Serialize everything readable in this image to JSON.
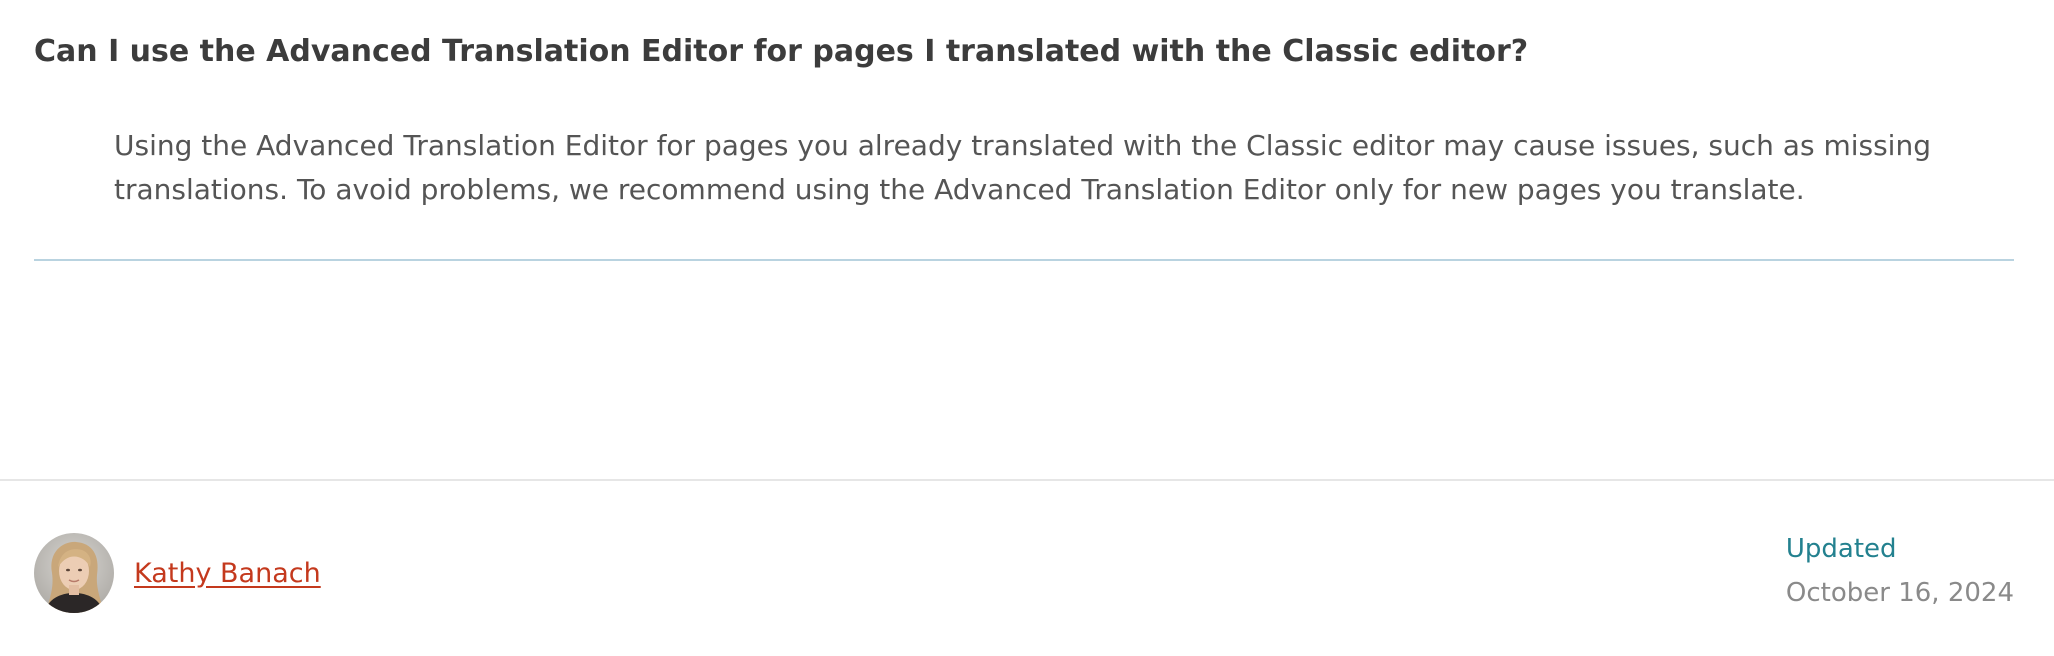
{
  "faq": {
    "question": "Can I use the Advanced Translation Editor for pages I translated with the Classic editor?",
    "answer": "Using the Advanced Translation Editor for pages you already translated with the Classic editor may cause issues, such as missing translations. To avoid problems, we recommend using the Advanced Translation Editor only for new pages you translate."
  },
  "footer": {
    "author": {
      "name": "Kathy Banach",
      "avatar_icon": "author-photo-avatar"
    },
    "updated": {
      "label": "Updated",
      "date": "October 16, 2024"
    }
  },
  "colors": {
    "author_link": "#c4391d",
    "updated_label": "#23818f",
    "answer_divider": "#b9d3e0"
  }
}
